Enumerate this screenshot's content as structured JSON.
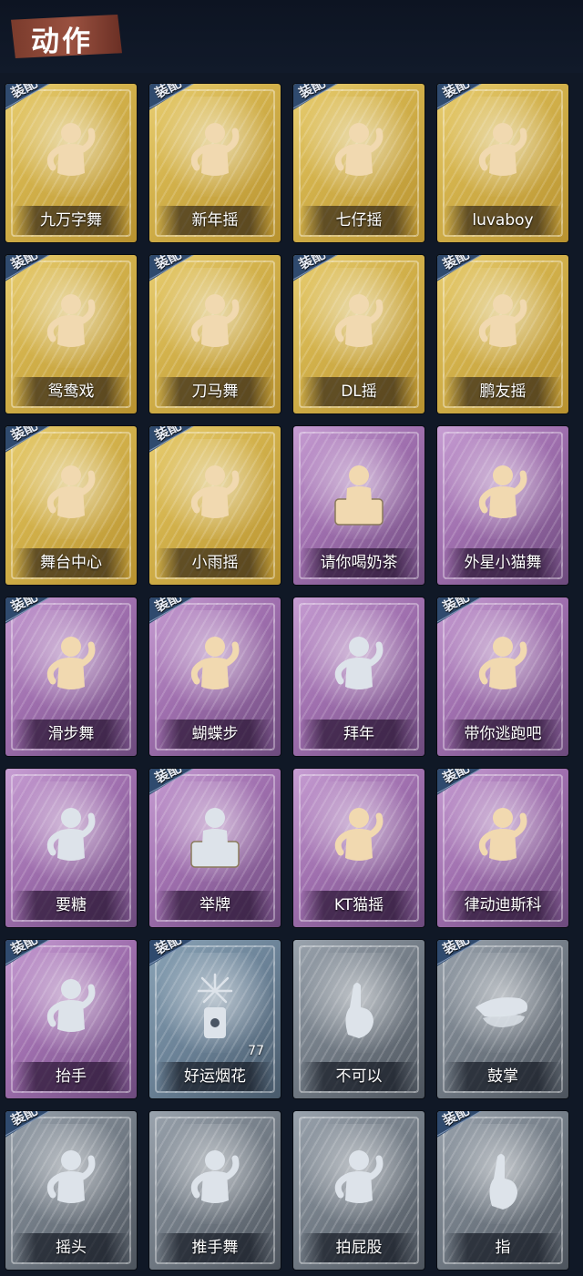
{
  "header": {
    "title": "动作"
  },
  "equip_label": "装配",
  "colors": {
    "gold": "#d3b24c",
    "purple": "#9f6fae",
    "gray": "#717a84",
    "bluegray": "#6a8196",
    "equip_tag": "#2f4a6e",
    "figure_gold": "#f1d9b0",
    "figure_silver": "#dde3ea"
  },
  "actions": [
    {
      "name": "九万字舞",
      "rarity": "gold",
      "equipped": true,
      "icon": "dance-figure-icon"
    },
    {
      "name": "新年摇",
      "rarity": "gold",
      "equipped": true,
      "icon": "dance-figure-icon"
    },
    {
      "name": "七仔摇",
      "rarity": "gold",
      "equipped": true,
      "icon": "dance-figure-icon"
    },
    {
      "name": "luvaboy",
      "rarity": "gold",
      "equipped": true,
      "icon": "dance-figure-icon"
    },
    {
      "name": "鸳鸯戏",
      "rarity": "gold",
      "equipped": true,
      "icon": "dance-figure-icon"
    },
    {
      "name": "刀马舞",
      "rarity": "gold",
      "equipped": true,
      "icon": "dance-figure-icon"
    },
    {
      "name": "DL摇",
      "rarity": "gold",
      "equipped": true,
      "icon": "dance-figure-icon"
    },
    {
      "name": "鹏友摇",
      "rarity": "gold",
      "equipped": true,
      "icon": "dance-figure-icon"
    },
    {
      "name": "舞台中心",
      "rarity": "gold",
      "equipped": true,
      "icon": "dance-figure-icon"
    },
    {
      "name": "小雨摇",
      "rarity": "gold",
      "equipped": true,
      "icon": "dance-figure-icon"
    },
    {
      "name": "请你喝奶茶",
      "rarity": "purple",
      "equipped": false,
      "icon": "holding-sign-icon"
    },
    {
      "name": "外星小猫舞",
      "rarity": "purple",
      "equipped": false,
      "icon": "dance-figure-icon"
    },
    {
      "name": "滑步舞",
      "rarity": "purple",
      "equipped": true,
      "icon": "dance-figure-icon"
    },
    {
      "name": "蝴蝶步",
      "rarity": "purple",
      "equipped": true,
      "icon": "dance-figure-icon"
    },
    {
      "name": "拜年",
      "rarity": "purple",
      "equipped": false,
      "icon": "bow-figure-icon"
    },
    {
      "name": "带你逃跑吧",
      "rarity": "purple",
      "equipped": true,
      "icon": "dance-figure-icon"
    },
    {
      "name": "要糖",
      "rarity": "purple",
      "equipped": false,
      "icon": "reach-figure-icon"
    },
    {
      "name": "举牌",
      "rarity": "purple",
      "equipped": true,
      "icon": "holding-sign-icon"
    },
    {
      "name": "KT猫摇",
      "rarity": "purple",
      "equipped": false,
      "icon": "dance-figure-icon"
    },
    {
      "name": "律动迪斯科",
      "rarity": "purple",
      "equipped": true,
      "icon": "disco-figure-icon"
    },
    {
      "name": "抬手",
      "rarity": "purple",
      "equipped": true,
      "icon": "raise-hand-figure-icon"
    },
    {
      "name": "好运烟花",
      "rarity": "bluegray",
      "equipped": true,
      "icon": "firework-icon",
      "count": "77"
    },
    {
      "name": "不可以",
      "rarity": "gray",
      "equipped": false,
      "icon": "finger-wag-icon"
    },
    {
      "name": "鼓掌",
      "rarity": "gray",
      "equipped": true,
      "icon": "clap-hands-icon"
    },
    {
      "name": "摇头",
      "rarity": "gray",
      "equipped": true,
      "icon": "dance-figure-icon"
    },
    {
      "name": "推手舞",
      "rarity": "gray",
      "equipped": false,
      "icon": "dance-figure-icon"
    },
    {
      "name": "拍屁股",
      "rarity": "gray",
      "equipped": false,
      "icon": "dance-figure-icon"
    },
    {
      "name": "指",
      "rarity": "gray",
      "equipped": true,
      "icon": "pointing-hand-icon"
    }
  ]
}
